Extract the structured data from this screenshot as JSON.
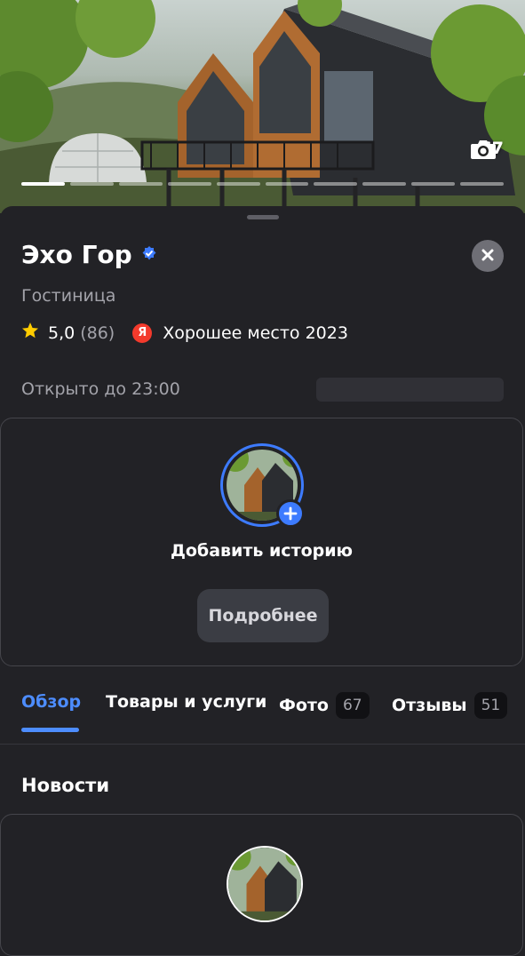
{
  "gallery": {
    "photo_count": "67",
    "progress_segments": 10,
    "active_segment": 0
  },
  "place": {
    "name": "Эхо Гор",
    "category": "Гостиница",
    "rating": "5,0",
    "reviews_count": "(86)",
    "award_badge": "Я",
    "award": "Хорошее место 2023",
    "hours": "Открыто до 23:00"
  },
  "stories": {
    "label": "Добавить историю",
    "more_button": "Подробнее"
  },
  "tabs": [
    {
      "label": "Обзор",
      "count": ""
    },
    {
      "label": "Товары и услуги",
      "count": ""
    },
    {
      "label": "Фото",
      "count": "67"
    },
    {
      "label": "Отзывы",
      "count": "51"
    }
  ],
  "news": {
    "title": "Новости"
  },
  "colors": {
    "accent": "#4d8dff",
    "verified": "#3d7bff",
    "star": "#ffcc00",
    "yandex_red": "#f33a2c"
  }
}
